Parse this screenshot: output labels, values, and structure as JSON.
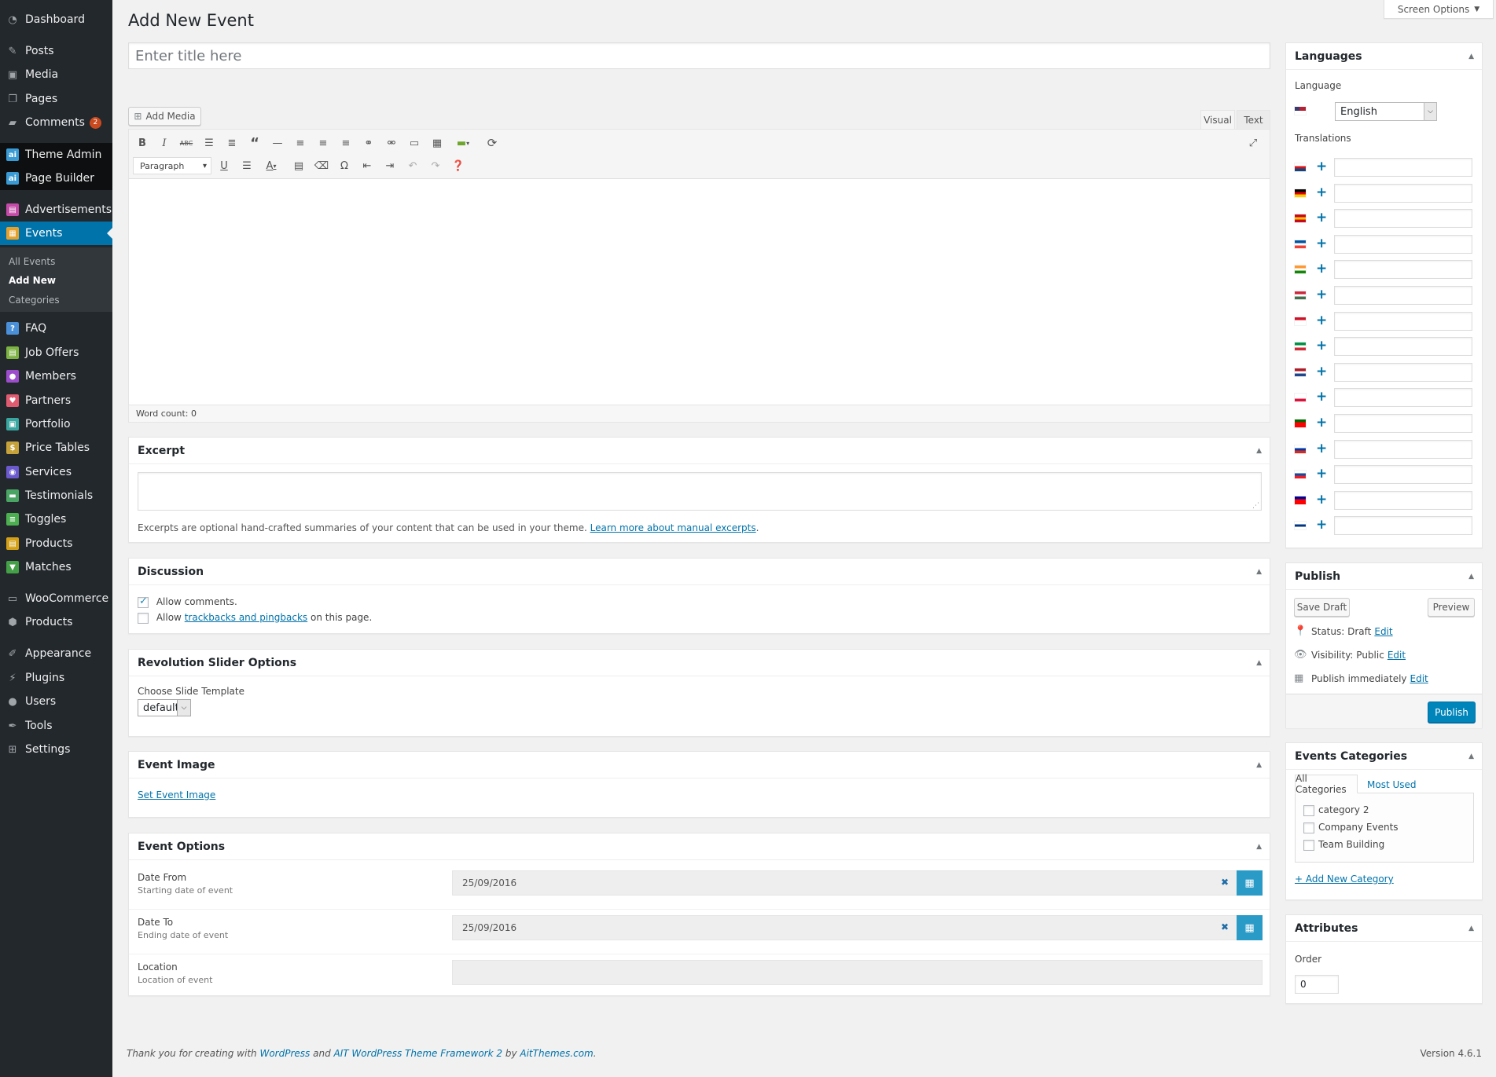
{
  "menu": {
    "items": [
      {
        "label": "Dashboard",
        "icon": "dashboard-icon"
      },
      {
        "label": "Posts",
        "icon": "pin-icon"
      },
      {
        "label": "Media",
        "icon": "media-icon"
      },
      {
        "label": "Pages",
        "icon": "pages-icon"
      },
      {
        "label": "Comments",
        "icon": "comment-icon",
        "badge": "2"
      },
      {
        "label": "Theme Admin",
        "icon": "ait-icon"
      },
      {
        "label": "Page Builder",
        "icon": "ait-icon"
      },
      {
        "label": "Advertisements",
        "icon": "ads-icon"
      },
      {
        "label": "Events",
        "icon": "events-icon"
      },
      {
        "label": "FAQ",
        "icon": "faq-icon"
      },
      {
        "label": "Job Offers",
        "icon": "job-icon"
      },
      {
        "label": "Members",
        "icon": "members-icon"
      },
      {
        "label": "Partners",
        "icon": "partners-icon"
      },
      {
        "label": "Portfolio",
        "icon": "portfolio-icon"
      },
      {
        "label": "Price Tables",
        "icon": "price-icon"
      },
      {
        "label": "Services",
        "icon": "services-icon"
      },
      {
        "label": "Testimonials",
        "icon": "testimonials-icon"
      },
      {
        "label": "Toggles",
        "icon": "toggles-icon"
      },
      {
        "label": "Products",
        "icon": "products-icon"
      },
      {
        "label": "Matches",
        "icon": "matches-icon"
      },
      {
        "label": "WooCommerce",
        "icon": "woo-icon"
      },
      {
        "label": "Products",
        "icon": "archive-icon"
      },
      {
        "label": "Appearance",
        "icon": "brush-icon"
      },
      {
        "label": "Plugins",
        "icon": "plugin-icon"
      },
      {
        "label": "Users",
        "icon": "user-icon"
      },
      {
        "label": "Tools",
        "icon": "wrench-icon"
      },
      {
        "label": "Settings",
        "icon": "settings-icon"
      }
    ],
    "submenu": [
      "All Events",
      "Add New",
      "Categories"
    ]
  },
  "screen_options": "Screen Options",
  "page_title": "Add New Event",
  "title_placeholder": "Enter title here",
  "editor": {
    "add_media": "Add Media",
    "tab_visual": "Visual",
    "tab_text": "Text",
    "format": "Paragraph",
    "word_count": "Word count: 0"
  },
  "excerpt": {
    "title": "Excerpt",
    "help": "Excerpts are optional hand-crafted summaries of your content that can be used in your theme.",
    "link": "Learn more about manual excerpts",
    "period": "."
  },
  "discussion": {
    "title": "Discussion",
    "allow_comments": "Allow comments.",
    "allow_prefix": "Allow",
    "trackbacks_link": "trackbacks and pingbacks",
    "allow_suffix": "on this page."
  },
  "revslider": {
    "title": "Revolution Slider Options",
    "label": "Choose Slide Template",
    "value": "default"
  },
  "event_image": {
    "title": "Event Image",
    "link": "Set Event Image"
  },
  "event_options": {
    "title": "Event Options",
    "fields": [
      {
        "label": "Date From",
        "desc": "Starting date of event",
        "value": "25/09/2016"
      },
      {
        "label": "Date To",
        "desc": "Ending date of event",
        "value": "25/09/2016"
      },
      {
        "label": "Location",
        "desc": "Location of event",
        "value": ""
      }
    ]
  },
  "languages": {
    "title": "Languages",
    "language_label": "Language",
    "language_value": "English",
    "translations_label": "Translations",
    "flags": [
      {
        "name": "czech-flag",
        "colors": [
          "#ffffff",
          "#d7141a",
          "#11457e"
        ]
      },
      {
        "name": "german-flag",
        "colors": [
          "#000000",
          "#dd0000",
          "#ffce00"
        ]
      },
      {
        "name": "spanish-flag",
        "colors": [
          "#c60b1e",
          "#ffc400",
          "#c60b1e"
        ]
      },
      {
        "name": "french-flag",
        "colors": [
          "#0055a4",
          "#ffffff",
          "#ef4135"
        ]
      },
      {
        "name": "india-flag",
        "colors": [
          "#ff9933",
          "#ffffff",
          "#138808"
        ]
      },
      {
        "name": "hungarian-flag",
        "colors": [
          "#cd2a3e",
          "#ffffff",
          "#436f4d"
        ]
      },
      {
        "name": "indonesian-flag",
        "colors": [
          "#ce1126",
          "#ffffff",
          "#ffffff"
        ]
      },
      {
        "name": "italian-flag",
        "colors": [
          "#009246",
          "#ffffff",
          "#ce2b37"
        ]
      },
      {
        "name": "dutch-flag",
        "colors": [
          "#ae1c28",
          "#ffffff",
          "#21468b"
        ]
      },
      {
        "name": "polish-flag",
        "colors": [
          "#ffffff",
          "#ffffff",
          "#dc143c"
        ]
      },
      {
        "name": "portuguese-flag",
        "colors": [
          "#006600",
          "#ff0000",
          "#ff0000"
        ]
      },
      {
        "name": "russian-flag",
        "colors": [
          "#ffffff",
          "#0039a6",
          "#d52b1e"
        ]
      },
      {
        "name": "slovak-flag",
        "colors": [
          "#ffffff",
          "#0b4ea2",
          "#ee1c25"
        ]
      },
      {
        "name": "taiwan-flag",
        "colors": [
          "#000095",
          "#fe0000",
          "#fe0000"
        ]
      },
      {
        "name": "finnish-flag",
        "colors": [
          "#ffffff",
          "#003580",
          "#ffffff"
        ]
      }
    ]
  },
  "publish": {
    "title": "Publish",
    "save_draft": "Save Draft",
    "preview": "Preview",
    "status_label": "Status:",
    "status_value": "Draft",
    "visibility_label": "Visibility:",
    "visibility_value": "Public",
    "schedule": "Publish immediately",
    "edit": "Edit",
    "publish_button": "Publish"
  },
  "categories": {
    "title": "Events Categories",
    "tab_all": "All Categories",
    "tab_most_used": "Most Used",
    "items": [
      "category 2",
      "Company Events",
      "Team Building"
    ],
    "add_new": "+ Add New Category"
  },
  "attributes": {
    "title": "Attributes",
    "order_label": "Order",
    "order_value": "0"
  },
  "footer": {
    "thanks": "Thank you for creating with",
    "wp": "WordPress",
    "and": "and",
    "ait": "AIT WordPress Theme Framework 2",
    "by": "by",
    "aitthemes": "AitThemes.com",
    "period": ".",
    "version": "Version 4.6.1"
  },
  "colors": {
    "sidebar": "#23282d",
    "accent": "#0073aa",
    "cal_button": "#2a9bc7",
    "badge": "#ca4a1f"
  }
}
